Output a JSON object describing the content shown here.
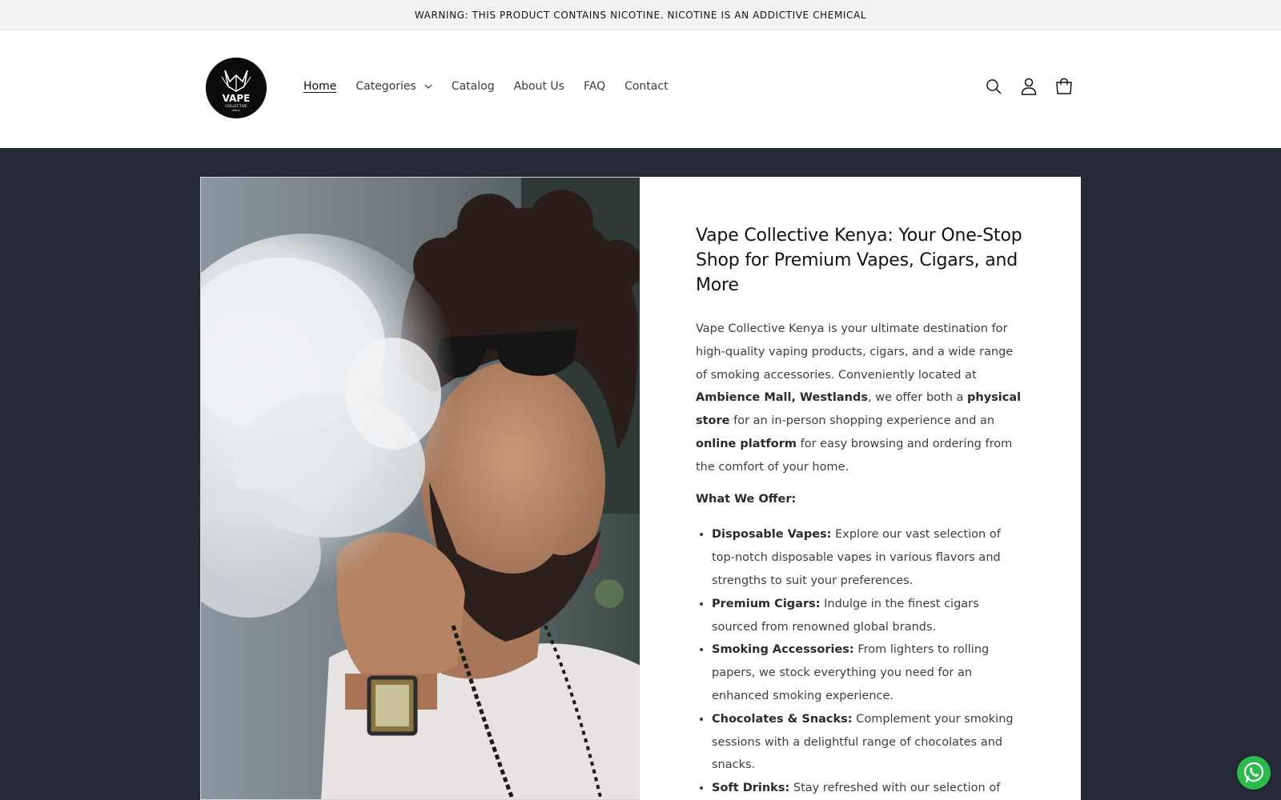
{
  "announcement": {
    "text": "WARNING: THIS PRODUCT CONTAINS NICOTINE. NICOTINE IS AN ADDICTIVE CHEMICAL"
  },
  "header": {
    "logo": {
      "brand": "VAPE",
      "sub": "COLLECTIVE",
      "country": "KENYA"
    },
    "nav": [
      {
        "label": "Home",
        "active": true
      },
      {
        "label": "Categories",
        "has_dropdown": true
      },
      {
        "label": "Catalog"
      },
      {
        "label": "About Us"
      },
      {
        "label": "FAQ"
      },
      {
        "label": "Contact"
      }
    ],
    "icons": [
      "search-icon",
      "account-icon",
      "cart-icon"
    ]
  },
  "hero": {
    "image_alt": "Man with curly hair and sunglasses exhaling vape smoke",
    "title": "Vape Collective Kenya: Your One-Stop Shop for Premium Vapes, Cigars, and More",
    "intro": {
      "t1": "Vape Collective Kenya is your ultimate destination for high-quality vaping products, cigars, and a wide range of smoking accessories. Conveniently located at ",
      "b1": "Ambience Mall, Westlands",
      "t2": ", we offer both a ",
      "b2": "physical store",
      "t3": " for an in-person shopping experience and an ",
      "b3": "online platform",
      "t4": " for easy browsing and ordering from the comfort of your home."
    },
    "offer_heading": "What We Offer:",
    "offers": [
      {
        "title": "Disposable Vapes:",
        "text": " Explore our vast selection of top-notch disposable vapes in various flavors and strengths to suit your preferences."
      },
      {
        "title": "Premium Cigars:",
        "text": " Indulge in the finest cigars sourced from renowned global brands."
      },
      {
        "title": "Smoking Accessories:",
        "text": " From lighters to rolling papers, we stock everything you need for an enhanced smoking experience."
      },
      {
        "title": "Chocolates & Snacks:",
        "text": " Complement your smoking sessions with a delightful range of chocolates and snacks."
      },
      {
        "title": "Soft Drinks:",
        "text": " Stay refreshed with our selection of"
      }
    ]
  },
  "floating": {
    "whatsapp_icon": "whatsapp-icon",
    "color": "#2dbb4d"
  },
  "colors": {
    "page_bg": "#262a36",
    "announcement_bg": "#f3f3f3",
    "panel_bg": "#ffffff"
  }
}
